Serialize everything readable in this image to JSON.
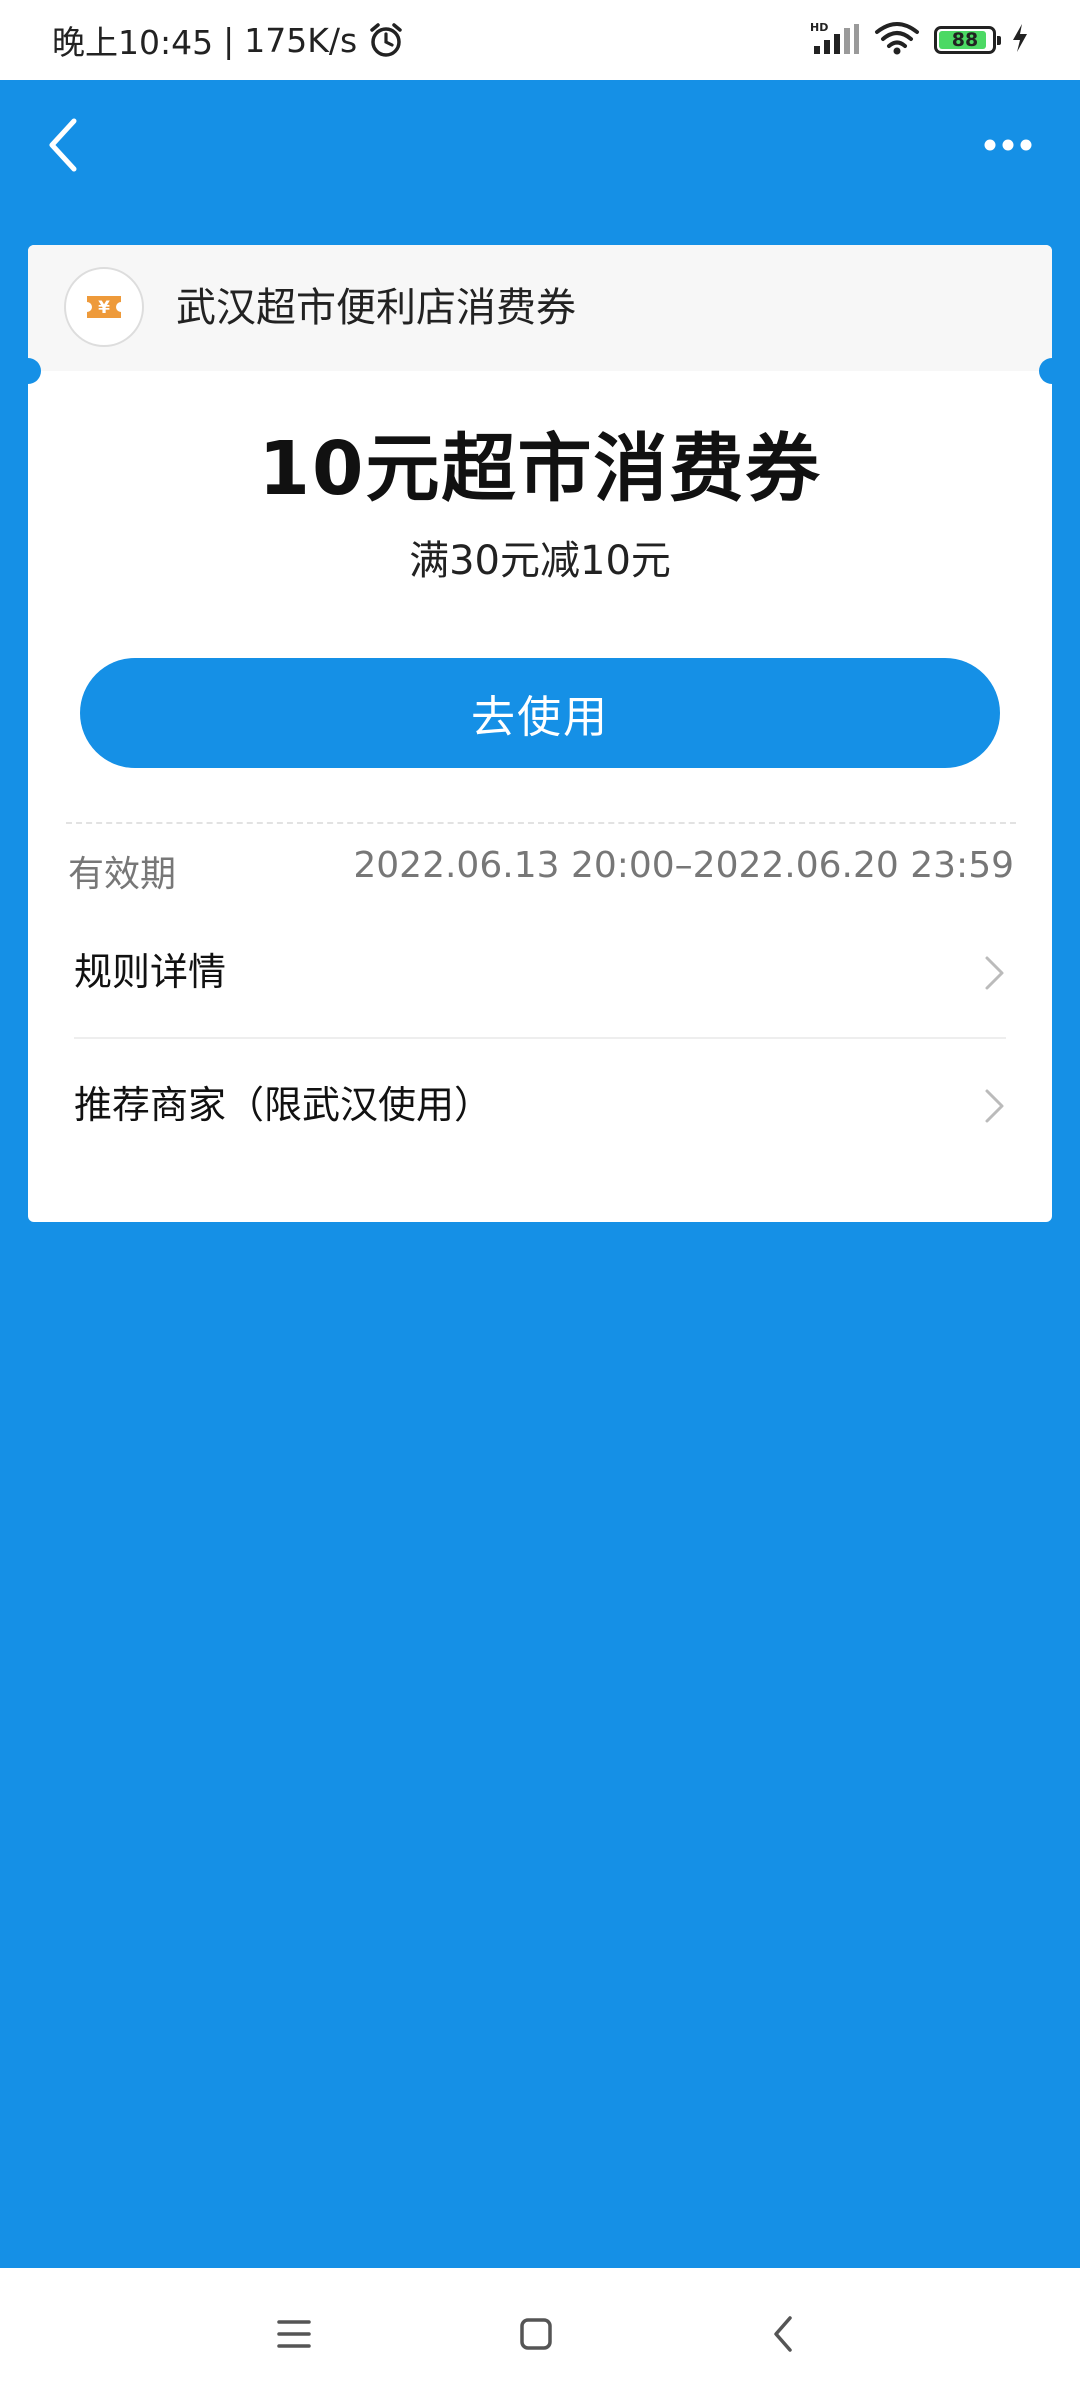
{
  "status_bar": {
    "time": "晚上10:45",
    "speed": "175K/s",
    "network_badge": "HD",
    "battery": "88",
    "icons": [
      "alarm-icon",
      "signal-icon",
      "wifi-icon",
      "battery-icon",
      "charging-icon"
    ]
  },
  "nav": {
    "icons": [
      "back-arrow-icon",
      "more-dots-icon"
    ]
  },
  "coupon": {
    "merchant": "武汉超市便利店消费券",
    "title": "10元超市消费券",
    "condition": "满30元减10元",
    "use_button": "去使用",
    "validity_label": "有效期",
    "validity_value": "2022.06.13 20:00–2022.06.20 23:59",
    "rows": [
      {
        "label": "规则详情"
      },
      {
        "label": "推荐商家（限武汉使用）"
      }
    ],
    "logo_symbol": "¥"
  },
  "colors": {
    "primary": "#1590E6",
    "logo_orange": "#EE9A3A",
    "battery_green": "#4CD964"
  },
  "system_nav": {
    "icons": [
      "menu-icon",
      "home-icon",
      "back-icon"
    ]
  }
}
